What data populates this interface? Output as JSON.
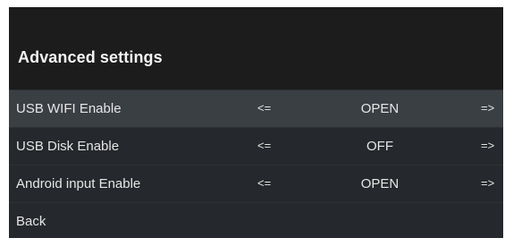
{
  "header": {
    "title": "Advanced settings"
  },
  "settings": [
    {
      "label": "USB WIFI Enable",
      "prev": "<=",
      "value": "OPEN",
      "next": "=>",
      "selected": true
    },
    {
      "label": "USB Disk Enable",
      "prev": "<=",
      "value": "OFF",
      "next": "=>",
      "selected": false
    },
    {
      "label": "Android input Enable",
      "prev": "<=",
      "value": "OPEN",
      "next": "=>",
      "selected": false
    }
  ],
  "back": {
    "label": "Back"
  },
  "colors": {
    "background": "#1c1c1c",
    "row": "#25282c",
    "selected_row": "#3a3f44",
    "text": "#e6e6e6"
  }
}
